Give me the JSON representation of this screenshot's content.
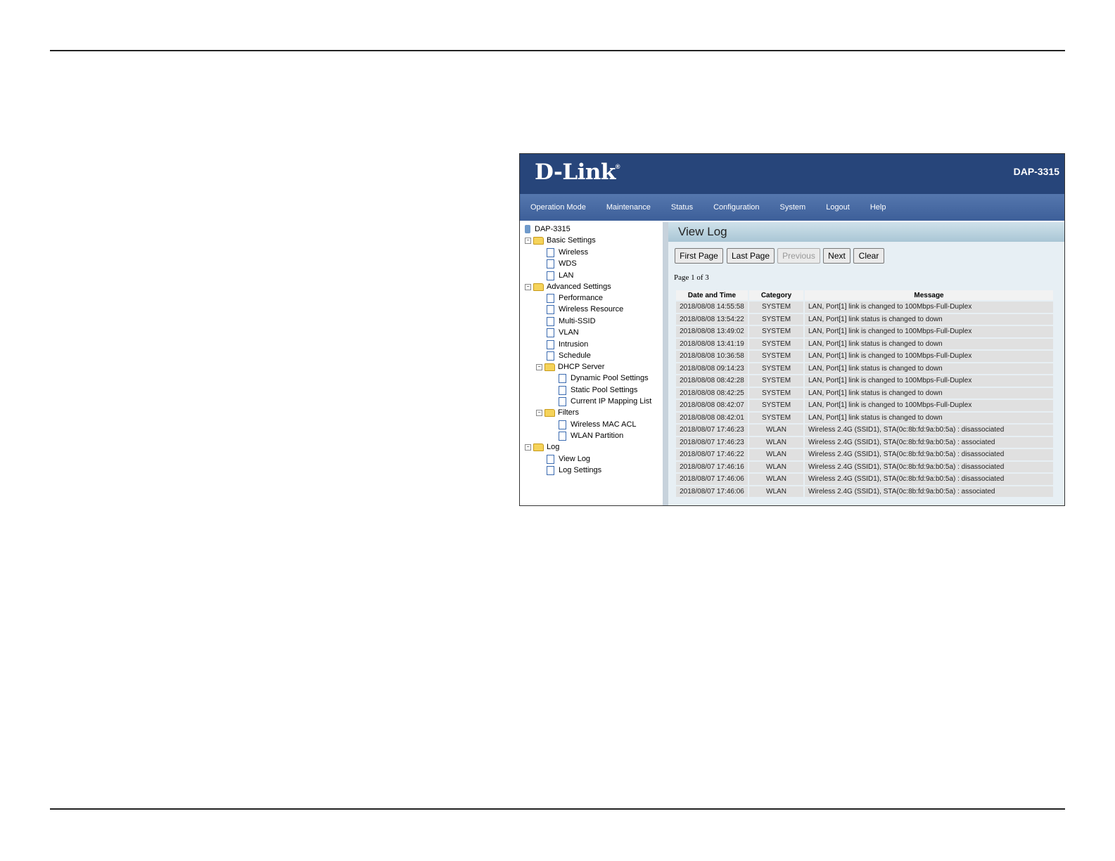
{
  "header": {
    "logo": "D-Link",
    "model": "DAP-3315"
  },
  "menu": [
    "Operation Mode",
    "Maintenance",
    "Status",
    "Configuration",
    "System",
    "Logout",
    "Help"
  ],
  "tree": {
    "root": "DAP-3315",
    "basic": {
      "label": "Basic Settings",
      "items": [
        "Wireless",
        "WDS",
        "LAN"
      ]
    },
    "advanced": {
      "label": "Advanced Settings",
      "items": [
        "Performance",
        "Wireless Resource",
        "Multi-SSID",
        "VLAN",
        "Intrusion",
        "Schedule"
      ],
      "dhcp": {
        "label": "DHCP Server",
        "items": [
          "Dynamic Pool Settings",
          "Static Pool Settings",
          "Current IP Mapping List"
        ]
      },
      "filters": {
        "label": "Filters",
        "items": [
          "Wireless MAC ACL",
          "WLAN Partition"
        ]
      }
    },
    "log": {
      "label": "Log",
      "items": [
        "View Log",
        "Log Settings"
      ]
    }
  },
  "content": {
    "title": "View Log",
    "buttons": {
      "first": "First Page",
      "last": "Last Page",
      "previous": "Previous",
      "next": "Next",
      "clear": "Clear"
    },
    "page_info": "Page 1 of 3",
    "table": {
      "headers": [
        "Date and Time",
        "Category",
        "Message"
      ],
      "rows": [
        [
          "2018/08/08 14:55:58",
          "SYSTEM",
          "LAN, Port[1] link is changed to 100Mbps-Full-Duplex"
        ],
        [
          "2018/08/08 13:54:22",
          "SYSTEM",
          "LAN, Port[1] link status is changed to down"
        ],
        [
          "2018/08/08 13:49:02",
          "SYSTEM",
          "LAN, Port[1] link is changed to 100Mbps-Full-Duplex"
        ],
        [
          "2018/08/08 13:41:19",
          "SYSTEM",
          "LAN, Port[1] link status is changed to down"
        ],
        [
          "2018/08/08 10:36:58",
          "SYSTEM",
          "LAN, Port[1] link is changed to 100Mbps-Full-Duplex"
        ],
        [
          "2018/08/08 09:14:23",
          "SYSTEM",
          "LAN, Port[1] link status is changed to down"
        ],
        [
          "2018/08/08 08:42:28",
          "SYSTEM",
          "LAN, Port[1] link is changed to 100Mbps-Full-Duplex"
        ],
        [
          "2018/08/08 08:42:25",
          "SYSTEM",
          "LAN, Port[1] link status is changed to down"
        ],
        [
          "2018/08/08 08:42:07",
          "SYSTEM",
          "LAN, Port[1] link is changed to 100Mbps-Full-Duplex"
        ],
        [
          "2018/08/08 08:42:01",
          "SYSTEM",
          "LAN, Port[1] link status is changed to down"
        ],
        [
          "2018/08/07 17:46:23",
          "WLAN",
          "Wireless 2.4G (SSID1), STA(0c:8b:fd:9a:b0:5a) : disassociated"
        ],
        [
          "2018/08/07 17:46:23",
          "WLAN",
          "Wireless 2.4G (SSID1), STA(0c:8b:fd:9a:b0:5a) : associated"
        ],
        [
          "2018/08/07 17:46:22",
          "WLAN",
          "Wireless 2.4G (SSID1), STA(0c:8b:fd:9a:b0:5a) : disassociated"
        ],
        [
          "2018/08/07 17:46:16",
          "WLAN",
          "Wireless 2.4G (SSID1), STA(0c:8b:fd:9a:b0:5a) : disassociated"
        ],
        [
          "2018/08/07 17:46:06",
          "WLAN",
          "Wireless 2.4G (SSID1), STA(0c:8b:fd:9a:b0:5a) : disassociated"
        ],
        [
          "2018/08/07 17:46:06",
          "WLAN",
          "Wireless 2.4G (SSID1), STA(0c:8b:fd:9a:b0:5a) : associated"
        ]
      ]
    }
  }
}
